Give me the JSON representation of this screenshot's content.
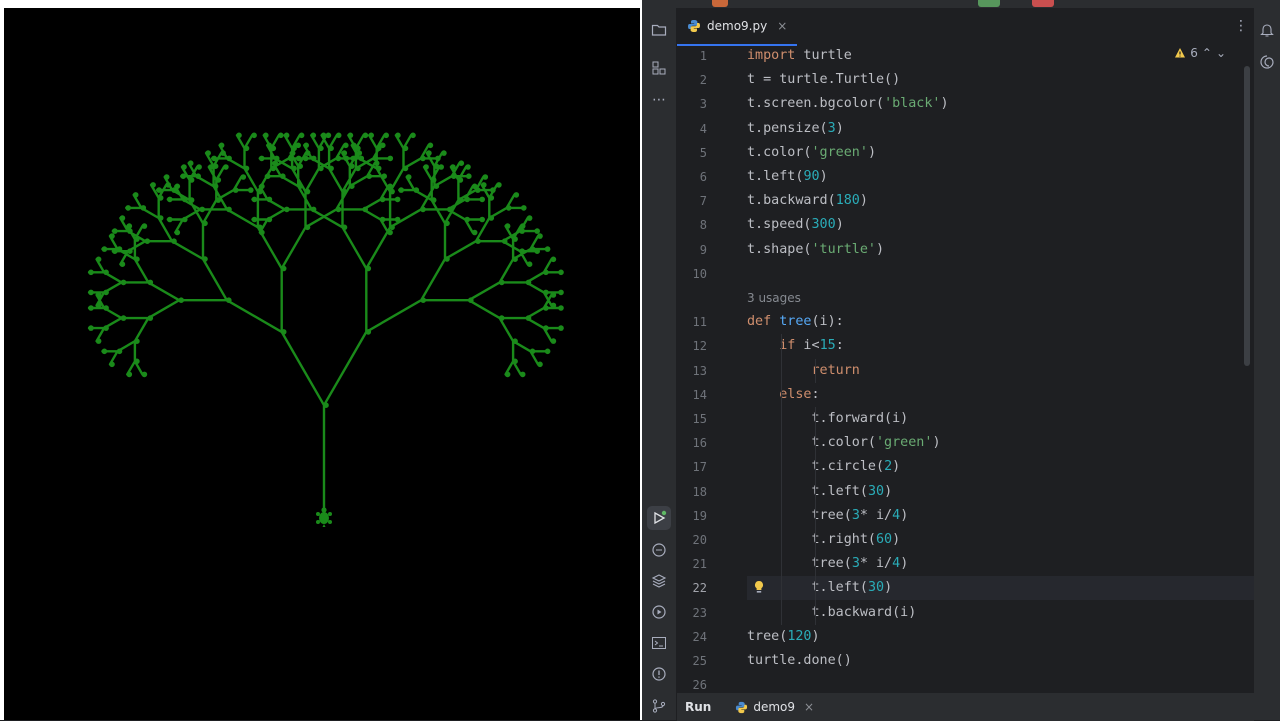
{
  "ide": {
    "tab": {
      "filename": "demo9.py",
      "close": "×"
    },
    "menu_icon": "⋮",
    "warnings_count": "6",
    "inlay_hint": "3 usages",
    "bottom": {
      "run_label": "Run",
      "run_config": "demo9",
      "close": "×"
    },
    "line_numbers": [
      "1",
      "2",
      "3",
      "4",
      "5",
      "6",
      "7",
      "8",
      "9",
      "10",
      "11",
      "12",
      "13",
      "14",
      "15",
      "16",
      "17",
      "18",
      "19",
      "20",
      "21",
      "22",
      "23",
      "24",
      "25",
      "26"
    ],
    "current_line": "22"
  },
  "code": {
    "l1": [
      {
        "t": "import",
        "c": "kw"
      },
      {
        "t": " turtle",
        "c": ""
      }
    ],
    "l2": [
      {
        "t": "t = turtle.Turtle()",
        "c": ""
      }
    ],
    "l3": [
      {
        "t": "t.screen.bgcolor(",
        "c": ""
      },
      {
        "t": "'black'",
        "c": "str"
      },
      {
        "t": ")",
        "c": ""
      }
    ],
    "l4": [
      {
        "t": "t.pensize(",
        "c": ""
      },
      {
        "t": "3",
        "c": "num"
      },
      {
        "t": ")",
        "c": ""
      }
    ],
    "l5": [
      {
        "t": "t.color(",
        "c": ""
      },
      {
        "t": "'green'",
        "c": "str"
      },
      {
        "t": ")",
        "c": ""
      }
    ],
    "l6": [
      {
        "t": "t.left(",
        "c": ""
      },
      {
        "t": "90",
        "c": "num"
      },
      {
        "t": ")",
        "c": ""
      }
    ],
    "l7": [
      {
        "t": "t.backward(",
        "c": ""
      },
      {
        "t": "180",
        "c": "num"
      },
      {
        "t": ")",
        "c": ""
      }
    ],
    "l8": [
      {
        "t": "t.speed(",
        "c": ""
      },
      {
        "t": "300",
        "c": "num"
      },
      {
        "t": ")",
        "c": ""
      }
    ],
    "l9": [
      {
        "t": "t.shape(",
        "c": ""
      },
      {
        "t": "'turtle'",
        "c": "str"
      },
      {
        "t": ")",
        "c": ""
      }
    ],
    "l10": [],
    "l11": [
      {
        "t": "def ",
        "c": "kw"
      },
      {
        "t": "tree",
        "c": "fn"
      },
      {
        "t": "(i):",
        "c": ""
      }
    ],
    "l12": [
      {
        "t": "    ",
        "c": ""
      },
      {
        "t": "if",
        "c": "kw"
      },
      {
        "t": " i<",
        "c": ""
      },
      {
        "t": "15",
        "c": "num"
      },
      {
        "t": ":",
        "c": ""
      }
    ],
    "l13": [
      {
        "t": "        ",
        "c": ""
      },
      {
        "t": "return",
        "c": "kw"
      }
    ],
    "l14": [
      {
        "t": "    ",
        "c": ""
      },
      {
        "t": "else",
        "c": "kw"
      },
      {
        "t": ":",
        "c": ""
      }
    ],
    "l15": [
      {
        "t": "        t.forward(i)",
        "c": ""
      }
    ],
    "l16": [
      {
        "t": "        t.color(",
        "c": ""
      },
      {
        "t": "'green'",
        "c": "str"
      },
      {
        "t": ")",
        "c": ""
      }
    ],
    "l17": [
      {
        "t": "        t.circle(",
        "c": ""
      },
      {
        "t": "2",
        "c": "num"
      },
      {
        "t": ")",
        "c": ""
      }
    ],
    "l18": [
      {
        "t": "        t.left(",
        "c": ""
      },
      {
        "t": "30",
        "c": "num"
      },
      {
        "t": ")",
        "c": ""
      }
    ],
    "l19": [
      {
        "t": "        tree(",
        "c": ""
      },
      {
        "t": "3",
        "c": "num"
      },
      {
        "t": "* i/",
        "c": ""
      },
      {
        "t": "4",
        "c": "num"
      },
      {
        "t": ")",
        "c": ""
      }
    ],
    "l20": [
      {
        "t": "        t.right(",
        "c": ""
      },
      {
        "t": "60",
        "c": "num"
      },
      {
        "t": ")",
        "c": ""
      }
    ],
    "l21": [
      {
        "t": "        tree(",
        "c": ""
      },
      {
        "t": "3",
        "c": "num"
      },
      {
        "t": "* i/",
        "c": ""
      },
      {
        "t": "4",
        "c": "num"
      },
      {
        "t": ")",
        "c": ""
      }
    ],
    "l22": [
      {
        "t": "        t.left(",
        "c": ""
      },
      {
        "t": "30",
        "c": "num"
      },
      {
        "t": ")",
        "c": ""
      }
    ],
    "l23": [
      {
        "t": "        t.backward(i)",
        "c": ""
      }
    ],
    "l24": [
      {
        "t": "tree(",
        "c": ""
      },
      {
        "t": "120",
        "c": "num"
      },
      {
        "t": ")",
        "c": ""
      }
    ],
    "l25": [
      {
        "t": "turtle.done()",
        "c": ""
      }
    ],
    "l26": []
  },
  "turtle": {
    "background": "#000000",
    "pen_color": "#1a8a1a",
    "initial_length": 120,
    "min_length": 15
  },
  "colors": {
    "editor_bg": "#1e1f22",
    "keyword": "#cf8e6d",
    "string": "#6aab73",
    "number": "#2aacb8",
    "function": "#56a8f5"
  }
}
